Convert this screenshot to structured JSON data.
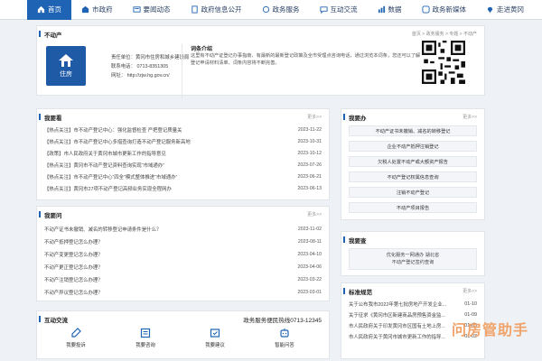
{
  "nav": [
    {
      "label": "首页",
      "icon": "home-icon",
      "active": true
    },
    {
      "label": "市政府",
      "icon": "building-icon"
    },
    {
      "label": "要闻动态",
      "icon": "news-icon"
    },
    {
      "label": "政府信息公开",
      "icon": "document-icon"
    },
    {
      "label": "政务服务",
      "icon": "service-icon"
    },
    {
      "label": "互动交流",
      "icon": "chat-icon"
    },
    {
      "label": "数据",
      "icon": "data-icon"
    },
    {
      "label": "政务新媒体",
      "icon": "media-icon"
    },
    {
      "label": "走进黄冈",
      "icon": "pin-icon"
    }
  ],
  "info": {
    "title": "不动产",
    "breadcrumb": "首页 > 政务服务 > 专题 > 不动产",
    "logo_label": "住房",
    "unit": "责任单位：黄冈市住房和城乡建设局",
    "phone": "联系电话：   0713-8351305",
    "website": "网址：    http://zjw.hg.gov.cn/",
    "intro_title": "词条介绍",
    "intro_text": "这里有不动产证登记办事指南、有最新的最新登记政策及全市受理点咨询电话，通过浏览本词条，您还可以了解登记申请材料清单、词条内容将不断完善。"
  },
  "news": {
    "title": "我要看",
    "more": "更多>>",
    "items": [
      {
        "text": "【热点关注】市不动产登记中心：强化监督检查 严把登记质量关",
        "date": "2023-11-22"
      },
      {
        "text": "【热点关注】市不动产登记中心多措查询打造不动产登记服务新高地",
        "date": "2023-10-31"
      },
      {
        "text": "【政策】市人民政府关于黄冈市城市更新工作的指导意见",
        "date": "2023-10-12"
      },
      {
        "text": "【热点关注】黄冈市不动产登记资料查询实现“市域通办”",
        "date": "2023-07-26"
      },
      {
        "text": "【热点关注】市不动产登记中心“四全”模式整体推进“市域通办”",
        "date": "2023-06-21"
      },
      {
        "text": "【热点关注】黄冈市27项不动产登记高频业务实现全程网办",
        "date": "2023-06-13"
      }
    ]
  },
  "ask": {
    "title": "我要问",
    "more": "更多>>",
    "items": [
      {
        "text": "不动产证书未撤销、减名的转移登记申请条件是什么？",
        "date": "2023-11-02"
      },
      {
        "text": "不动产抵押登记怎么办理？",
        "date": "2023-08-11"
      },
      {
        "text": "不动产变更登记怎么办理？",
        "date": "2023-04-10"
      },
      {
        "text": "不动产更正登记怎么办理？",
        "date": "2023-04-06"
      },
      {
        "text": "不动产注销登记怎么办理？",
        "date": "2023-03-22"
      },
      {
        "text": "不动产异议登记怎么办理？",
        "date": "2023-03-01"
      }
    ]
  },
  "interact": {
    "title": "互动交流",
    "hotline": "政务服务便民热线0713-12345",
    "actions": [
      {
        "label": "我要投诉",
        "icon": "complaint-icon"
      },
      {
        "label": "我要咨询",
        "icon": "consult-icon"
      },
      {
        "label": "我要建议",
        "icon": "suggest-icon"
      },
      {
        "label": "智能问答",
        "icon": "qa-icon"
      }
    ]
  },
  "handle": {
    "title": "我要办",
    "more": "更多>>",
    "items": [
      "不动产证书未撤销、减名的转移登记",
      "企业不动产抵押注销登记",
      "欠税人处置不动产或大额资产报告",
      "不动产登记权属信息查询",
      "注销不动产登记",
      "不动产项目报告"
    ]
  },
  "query": {
    "title": "我要查",
    "line1": "优化服务一网通办 湖北省",
    "line2": "不动产登记签约查询"
  },
  "standards": {
    "title": "标准规范",
    "more": "更多>>",
    "items": [
      {
        "text": "关于公布我市2022年第七批房地产开发企业...",
        "date": "01-10"
      },
      {
        "text": "关于征求《黄冈市区新建商品房预售资金监...",
        "date": "01-09"
      },
      {
        "text": "市人民政府关于印发黄冈市区国有土地上房...",
        "date": "01-09"
      },
      {
        "text": "市人民政府关于黄冈市城市更新工作的指导...",
        "date": "01-02"
      }
    ]
  },
  "watermark": "问房管助手",
  "colors": {
    "primary": "#1f63b4",
    "logo_bg": "#1f5aa6",
    "watermark": "#f0a36a"
  }
}
